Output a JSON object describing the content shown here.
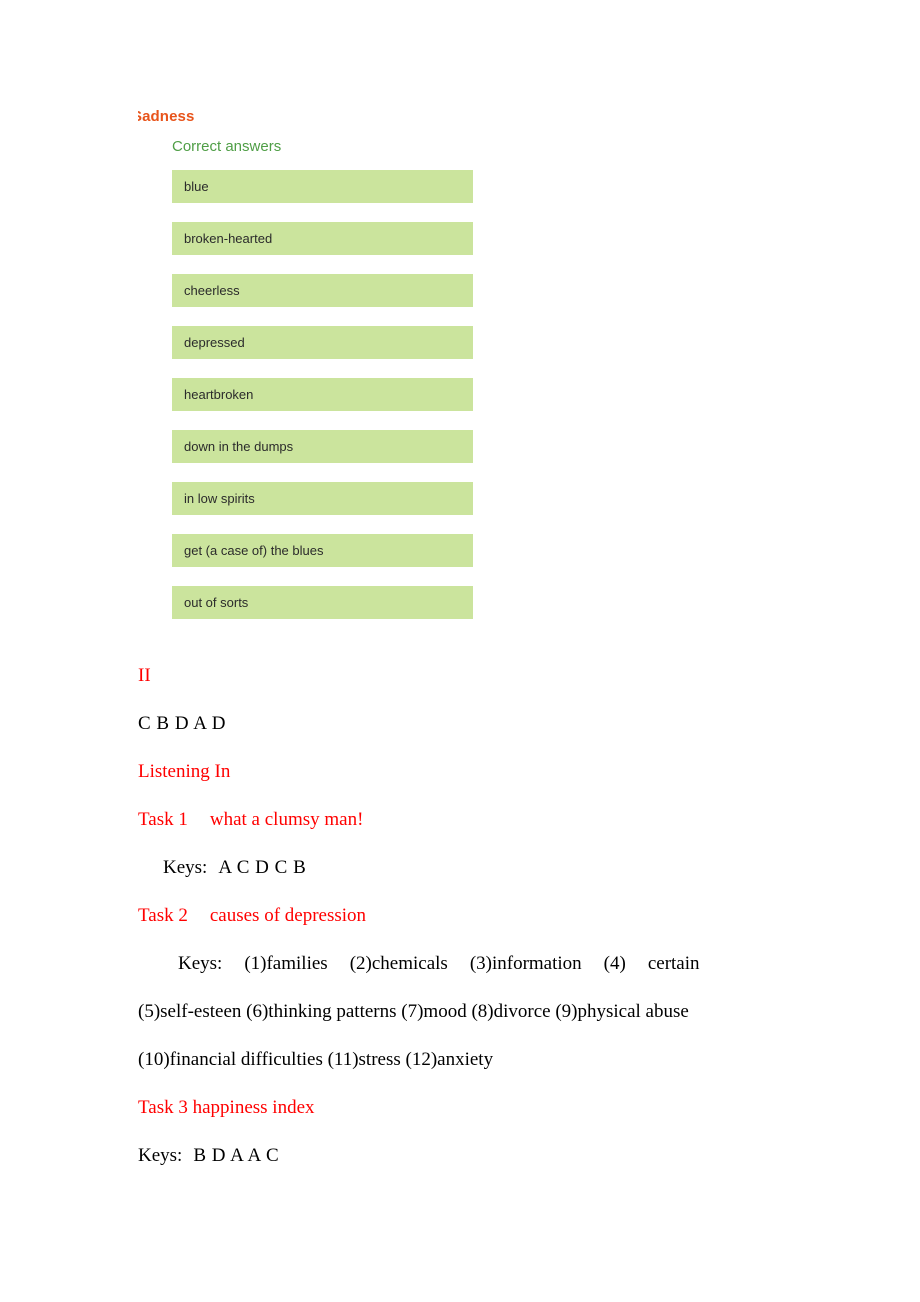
{
  "quiz": {
    "title": "Sadness",
    "subtitle": "Correct answers",
    "answers": [
      "blue",
      "broken-hearted",
      "cheerless",
      "depressed",
      "heartbroken",
      "down in the dumps",
      "in low spirits",
      "get (a case of) the blues",
      "out of sorts"
    ],
    "colors": {
      "title": "#e8541b",
      "subtitle": "#4f9e46",
      "answer_background": "#cbe49d",
      "answer_text": "#2b2b2b"
    }
  },
  "document": {
    "accent_color": "#ff0000",
    "section_ii": "II",
    "section_ii_keys": "C B D A D",
    "listening_in_heading": "Listening In",
    "task1": {
      "heading_label": "Task 1",
      "heading_title": "what a clumsy man!",
      "keys_label": "Keys:",
      "keys_value": "A C D C B"
    },
    "task2": {
      "heading_label": "Task 2",
      "heading_title": "causes of depression",
      "keys_label": "Keys:",
      "keys_line1": "(1)families",
      "keys_line1b": "(2)chemicals",
      "keys_line1c": "(3)information",
      "keys_line1d": "(4)",
      "keys_line1e": "certain",
      "keys_line2": "(5)self-esteen (6)thinking patterns (7)mood (8)divorce (9)physical abuse",
      "keys_line3": "(10)financial difficulties (11)stress (12)anxiety"
    },
    "task3": {
      "heading": "Task 3 happiness index",
      "keys_label": "Keys:",
      "keys_value": "B D A A C"
    }
  }
}
